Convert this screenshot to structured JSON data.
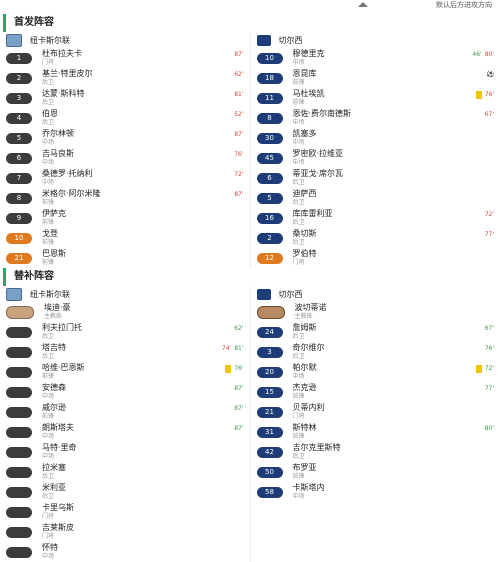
{
  "topbar": {
    "link": "默认后方进攻方向"
  },
  "sections": {
    "starting": "首发阵容",
    "subs": "替补阵容"
  },
  "teams": {
    "home": "纽卡斯尔联",
    "away": "切尔西"
  },
  "starters": {
    "home": [
      {
        "num": "1",
        "name": "杜布拉夫卡",
        "pos": "门将",
        "ev": [
          {
            "c": "r",
            "t": "87'"
          }
        ]
      },
      {
        "num": "2",
        "name": "基兰·特里皮尔",
        "pos": "后卫",
        "ev": [
          {
            "c": "r",
            "t": "62'"
          }
        ]
      },
      {
        "num": "3",
        "name": "达蒙·斯科特",
        "pos": "后卫",
        "ev": [
          {
            "c": "r",
            "t": "81'"
          }
        ]
      },
      {
        "num": "4",
        "name": "伯恩",
        "pos": "后卫",
        "ev": [
          {
            "c": "r",
            "t": "52'"
          }
        ]
      },
      {
        "num": "5",
        "name": "乔尔林顿",
        "pos": "中场",
        "ev": [
          {
            "c": "r",
            "t": "87'"
          }
        ]
      },
      {
        "num": "6",
        "name": "吉马良斯",
        "pos": "中场",
        "ev": [
          {
            "c": "r",
            "t": "76'"
          }
        ]
      },
      {
        "num": "7",
        "name": "桑德罗·托纳利",
        "pos": "中场",
        "ev": [
          {
            "c": "r",
            "t": "72'"
          }
        ]
      },
      {
        "num": "8",
        "name": "米格尔·阿尔米隆",
        "pos": "前锋",
        "ev": [
          {
            "c": "r",
            "t": "87'"
          }
        ]
      },
      {
        "num": "9",
        "name": "伊萨克",
        "pos": "前锋",
        "ev": []
      },
      {
        "num": "10",
        "name": "戈登",
        "pos": "前锋",
        "ev": []
      },
      {
        "num": "21",
        "name": "巴恩斯",
        "pos": "前锋",
        "ev": []
      }
    ],
    "away": [
      {
        "num": "10",
        "name": "穆德里克",
        "pos": "中场",
        "ev": [
          {
            "c": "g",
            "t": "46'"
          },
          {
            "c": "r",
            "t": "80'"
          }
        ]
      },
      {
        "num": "18",
        "name": "恩昆库",
        "pos": "前锋",
        "ev": [
          {
            "c": "k",
            "t": "⚽"
          }
        ]
      },
      {
        "num": "11",
        "name": "马杜埃凯",
        "pos": "前锋",
        "ev": [
          {
            "c": "y",
            "t": "Y"
          },
          {
            "c": "r",
            "t": "76'"
          }
        ]
      },
      {
        "num": "8",
        "name": "恩佐·费尔南德斯",
        "pos": "中场",
        "ev": [
          {
            "c": "r",
            "t": "67'"
          }
        ]
      },
      {
        "num": "30",
        "name": "凯塞多",
        "pos": "中场",
        "ev": []
      },
      {
        "num": "45",
        "name": "罗密欧·拉维亚",
        "pos": "中场",
        "ev": []
      },
      {
        "num": "6",
        "name": "蒂亚戈·席尔瓦",
        "pos": "后卫",
        "ev": []
      },
      {
        "num": "5",
        "name": "迪萨西",
        "pos": "后卫",
        "ev": []
      },
      {
        "num": "16",
        "name": "库库雷利亚",
        "pos": "后卫",
        "ev": [
          {
            "c": "r",
            "t": "72'"
          }
        ]
      },
      {
        "num": "2",
        "name": "桑切斯",
        "pos": "后卫",
        "ev": [
          {
            "c": "r",
            "t": "77'"
          }
        ]
      },
      {
        "num": "12",
        "name": "罗伯特",
        "pos": "门将",
        "ev": []
      }
    ]
  },
  "subs": {
    "home": [
      {
        "num": "",
        "name": "埃迪·豪",
        "pos": "主教练",
        "ev": [],
        "face": true
      },
      {
        "num": "",
        "name": "利夫拉门托",
        "pos": "后卫",
        "ev": [
          {
            "c": "g",
            "t": "62'"
          }
        ]
      },
      {
        "num": "",
        "name": "塔吉特",
        "pos": "后卫",
        "ev": [
          {
            "c": "r",
            "t": "74'"
          },
          {
            "c": "g",
            "t": "81'"
          }
        ]
      },
      {
        "num": "",
        "name": "哈维·巴恩斯",
        "pos": "前锋",
        "ev": [
          {
            "c": "y",
            "t": "Y"
          },
          {
            "c": "g",
            "t": "76'"
          }
        ]
      },
      {
        "num": "",
        "name": "安德森",
        "pos": "中场",
        "ev": [
          {
            "c": "g",
            "t": "87'"
          }
        ]
      },
      {
        "num": "",
        "name": "威尔逊",
        "pos": "前锋",
        "ev": [
          {
            "c": "g",
            "t": "87'"
          }
        ]
      },
      {
        "num": "",
        "name": "朗斯塔夫",
        "pos": "中场",
        "ev": [
          {
            "c": "g",
            "t": "87'"
          }
        ]
      },
      {
        "num": "",
        "name": "马特·里奇",
        "pos": "中场",
        "ev": []
      },
      {
        "num": "",
        "name": "拉米塞",
        "pos": "后卫",
        "ev": []
      },
      {
        "num": "",
        "name": "米利亚",
        "pos": "后卫",
        "ev": []
      },
      {
        "num": "",
        "name": "卡里乌斯",
        "pos": "门将",
        "ev": []
      },
      {
        "num": "",
        "name": "吉莱斯皮",
        "pos": "门将",
        "ev": []
      },
      {
        "num": "",
        "name": "怀特",
        "pos": "中场",
        "ev": []
      }
    ],
    "away": [
      {
        "num": "",
        "name": "波切蒂诺",
        "pos": "主教练",
        "ev": [],
        "face": true
      },
      {
        "num": "24",
        "name": "詹姆斯",
        "pos": "后卫",
        "ev": [
          {
            "c": "g",
            "t": "67'"
          }
        ]
      },
      {
        "num": "3",
        "name": "奇尔维尔",
        "pos": "后卫",
        "ev": [
          {
            "c": "g",
            "t": "76'"
          }
        ]
      },
      {
        "num": "20",
        "name": "帕尔默",
        "pos": "中场",
        "ev": [
          {
            "c": "y",
            "t": "Y"
          },
          {
            "c": "g",
            "t": "72'"
          }
        ]
      },
      {
        "num": "15",
        "name": "杰克逊",
        "pos": "前锋",
        "ev": [
          {
            "c": "g",
            "t": "77'"
          }
        ]
      },
      {
        "num": "21",
        "name": "贝蒂内利",
        "pos": "门将",
        "ev": []
      },
      {
        "num": "31",
        "name": "斯特林",
        "pos": "前锋",
        "ev": [
          {
            "c": "g",
            "t": "80'"
          }
        ]
      },
      {
        "num": "42",
        "name": "吉尔克里斯特",
        "pos": "后卫",
        "ev": []
      },
      {
        "num": "50",
        "name": "布罗亚",
        "pos": "前锋",
        "ev": []
      },
      {
        "num": "58",
        "name": "卡斯塔内",
        "pos": "中场",
        "ev": []
      }
    ]
  }
}
